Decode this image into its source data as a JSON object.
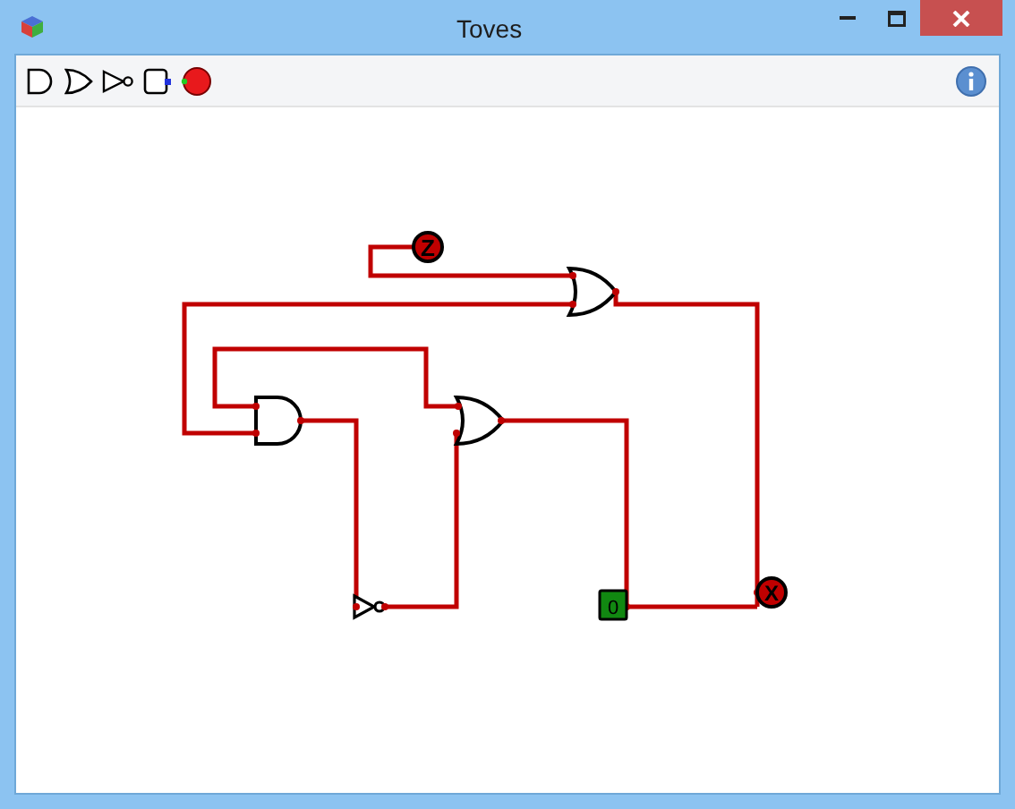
{
  "window": {
    "title": "Toves"
  },
  "toolbar": {
    "tools": [
      {
        "kind": "and"
      },
      {
        "kind": "or"
      },
      {
        "kind": "not"
      },
      {
        "kind": "switch"
      },
      {
        "kind": "probe"
      }
    ]
  },
  "circuit": {
    "gates": [
      {
        "kind": "or"
      },
      {
        "kind": "and"
      },
      {
        "kind": "or"
      },
      {
        "kind": "not"
      }
    ],
    "probe": {
      "label": "Z"
    },
    "switch": {
      "label": "0",
      "on": false
    },
    "output": {
      "label": "X"
    }
  }
}
